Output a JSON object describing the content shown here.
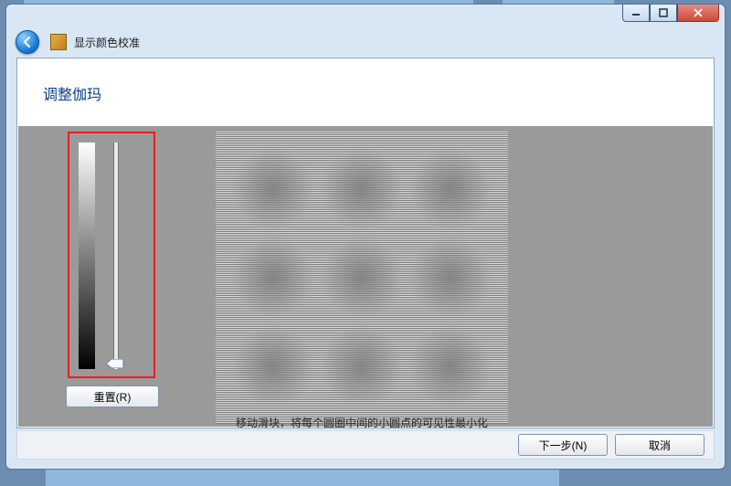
{
  "window": {
    "app_title": "显示颜色校准"
  },
  "page": {
    "heading": "调整伽玛",
    "instruction": "移动滑块，将每个圆圈中间的小圆点的可见性最小化"
  },
  "controls": {
    "reset_label": "重置(R)",
    "next_label": "下一步(N)",
    "cancel_label": "取消"
  },
  "slider": {
    "min": 0,
    "max": 100,
    "value": 95
  }
}
